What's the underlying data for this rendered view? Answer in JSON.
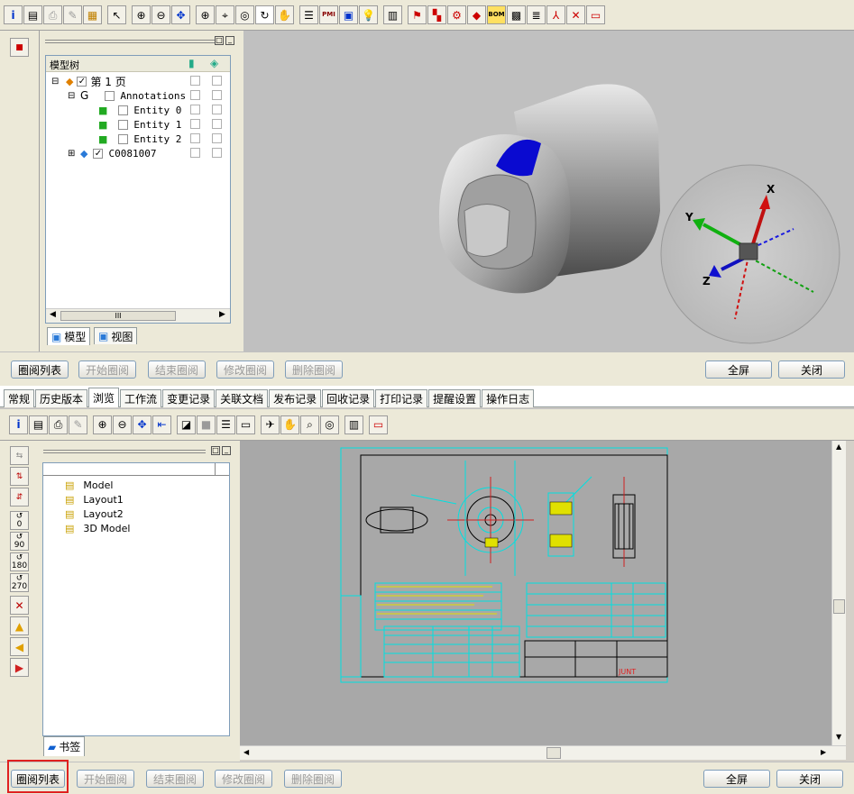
{
  "top": {
    "toolbar_icons": [
      "info-icon",
      "print-preview-icon",
      "print-icon",
      "pen-icon",
      "export-icon",
      "select-arrow-icon",
      "zoom-in-icon",
      "zoom-out-icon",
      "fit-icon",
      "zoom-window-icon",
      "zoom-area-icon",
      "zoom-select-icon",
      "rotate-icon",
      "pan-hand-icon",
      "layers-icon",
      "pmi-icon",
      "section-icon",
      "light-icon",
      "properties-icon",
      "tool-1-icon",
      "tool-2-icon",
      "tool-3-icon",
      "tool-4-icon",
      "bom-icon",
      "tool-5-icon",
      "tool-6-icon",
      "axis-icon",
      "explode-icon",
      "measure-icon"
    ],
    "pmi_label": "PMI",
    "bom_label": "BOM",
    "tree": {
      "header": "模型树",
      "page": "第 1 页",
      "group": "G",
      "annotations": "Annotations",
      "entities": [
        "Entity 0",
        "Entity 1",
        "Entity 2"
      ],
      "part": "C0081007",
      "scroll_mid": "III"
    },
    "bottom_tabs": {
      "model": "模型",
      "view": "视图"
    },
    "triad": {
      "x": "X",
      "y": "Y",
      "z": "Z"
    }
  },
  "review_buttons": {
    "list": "圈阅列表",
    "start": "开始圈阅",
    "end": "结束圈阅",
    "modify": "修改圈阅",
    "delete": "删除圈阅",
    "fullscreen": "全屏",
    "close": "关闭"
  },
  "tabs": [
    "常规",
    "历史版本",
    "浏览",
    "工作流",
    "变更记录",
    "关联文档",
    "发布记录",
    "回收记录",
    "打印记录",
    "提醒设置",
    "操作日志"
  ],
  "active_tab": "浏览",
  "bottom": {
    "layouts": [
      "Model",
      "Layout1",
      "Layout2",
      "3D Model"
    ],
    "bookmark_tab": "书签",
    "rotate_labels": [
      "0",
      "90",
      "180",
      "270"
    ],
    "drawing_brand": "JUNT"
  },
  "colors": {
    "viewport_bg": "#c0c0c0",
    "drawing_bg": "#a8a8a8",
    "cad_line": "#00e0e0",
    "highlight_red": "#e02020"
  }
}
